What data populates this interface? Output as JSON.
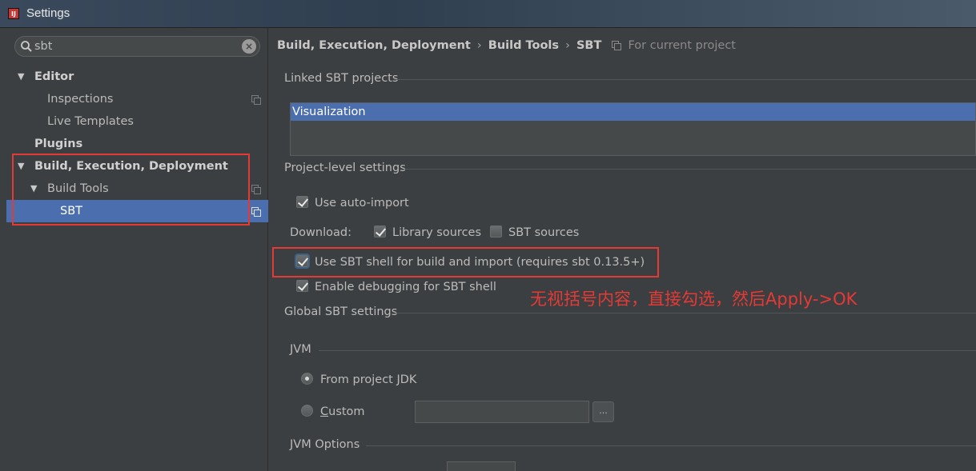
{
  "window": {
    "title": "Settings",
    "app_icon_text": "IJ"
  },
  "sidebar": {
    "search": {
      "value": "sbt",
      "placeholder": ""
    },
    "tree": [
      {
        "label": "Editor",
        "expanded": true,
        "bold": true
      },
      {
        "label": "Inspections"
      },
      {
        "label": "Live Templates"
      },
      {
        "label": "Plugins",
        "bold": true
      },
      {
        "label": "Build, Execution, Deployment",
        "expanded": true,
        "bold": true
      },
      {
        "label": "Build Tools",
        "expanded": true
      },
      {
        "label": "SBT",
        "selected": true
      }
    ]
  },
  "main": {
    "breadcrumb": {
      "part1": "Build, Execution, Deployment",
      "part2": "Build Tools",
      "part3": "SBT",
      "separator": "›",
      "scope": "For current project"
    },
    "linked_projects": {
      "title": "Linked SBT projects",
      "items": [
        "Visualization"
      ]
    },
    "project_level": {
      "title": "Project-level settings",
      "use_auto_import": {
        "label": "Use auto-import",
        "checked": true
      },
      "download_label": "Download:",
      "library_sources": {
        "label": "Library sources",
        "checked": true
      },
      "sbt_sources": {
        "label": "SBT sources",
        "checked": false
      },
      "use_sbt_shell": {
        "label": "Use SBT shell for build and import (requires sbt 0.13.5+)",
        "checked": true
      },
      "enable_debugging": {
        "label": "Enable debugging for SBT shell",
        "checked": true
      }
    },
    "global": {
      "title": "Global SBT settings",
      "jvm_title": "JVM",
      "from_project_jdk": {
        "label": "From project JDK",
        "selected": true
      },
      "custom": {
        "label_first": "C",
        "label_rest": "ustom",
        "selected": false,
        "value": ""
      },
      "browse_label": "...",
      "jvm_options_title": "JVM Options"
    },
    "annotation": "无视括号内容，直接勾选，然后Apply->OK"
  },
  "colors": {
    "background": "#3c3f41",
    "selection": "#4b6eaf",
    "annotation_red": "#e53935"
  }
}
